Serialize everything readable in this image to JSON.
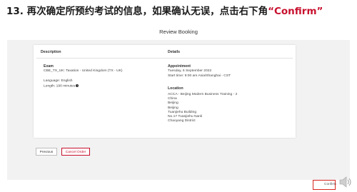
{
  "heading": {
    "text": "13. 再次确定所预约考试的信息，如果确认无误，点击右下角",
    "accent": "“Confirm”"
  },
  "page_title": "Review Booking",
  "columns": {
    "description": "Description",
    "details": "Details"
  },
  "exam": {
    "label": "Exam",
    "name": "CBE_TX_UK: Taxation - United Kingdom (TX - UK)",
    "language": "Language: English",
    "length": "Length: 190 minutes"
  },
  "appointment": {
    "label": "Appointment",
    "date": "Tuesday, 6 September 2022",
    "start": "Start time: 9:00 am Asia/Shanghai - CST"
  },
  "location": {
    "label": "Location",
    "lines": [
      "ACCA - Beijing Modern Business Training - 2",
      "China",
      "Beijing",
      "Beijing",
      "Tuanjiehu Building",
      "No.17 Tuanjiehu Nanli",
      "Chaoyang District"
    ]
  },
  "buttons": {
    "previous": "Previous",
    "cancel": "Cancel Order",
    "confirm": "Confirm"
  },
  "colors": {
    "accent": "#c8102e",
    "stage_bg": "#f2f2f2",
    "highlight_box": "#d9251d"
  },
  "icons": {
    "info": "info-icon",
    "speaker": "speaker-icon"
  }
}
